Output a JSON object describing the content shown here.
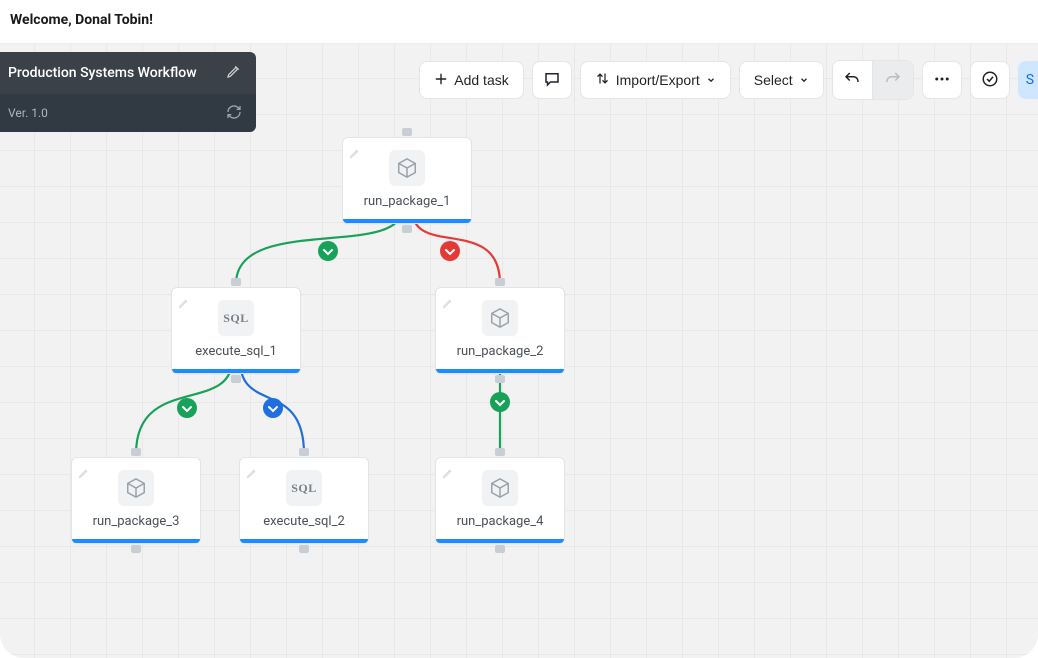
{
  "welcome_text": "Welcome, Donal Tobin!",
  "workflow": {
    "title": "Production Systems Workflow",
    "version": "Ver. 1.0"
  },
  "toolbar": {
    "add_task": "Add task",
    "import_export": "Import/Export",
    "select": "Select",
    "save_and_run": "S"
  },
  "nodes": {
    "run_package_1": {
      "label": "run_package_1",
      "type": "package"
    },
    "execute_sql_1": {
      "label": "execute_sql_1",
      "type": "sql"
    },
    "run_package_2": {
      "label": "run_package_2",
      "type": "package"
    },
    "run_package_3": {
      "label": "run_package_3",
      "type": "package"
    },
    "execute_sql_2": {
      "label": "execute_sql_2",
      "type": "sql"
    },
    "run_package_4": {
      "label": "run_package_4",
      "type": "package"
    }
  },
  "edges": [
    {
      "from": "run_package_1",
      "to": "execute_sql_1",
      "status": "success",
      "color": "#18a158"
    },
    {
      "from": "run_package_1",
      "to": "run_package_2",
      "status": "failure",
      "color": "#e53935"
    },
    {
      "from": "execute_sql_1",
      "to": "run_package_3",
      "status": "success",
      "color": "#18a158"
    },
    {
      "from": "execute_sql_1",
      "to": "execute_sql_2",
      "status": "completed",
      "color": "#1f6fde"
    },
    {
      "from": "run_package_2",
      "to": "run_package_4",
      "status": "success",
      "color": "#18a158"
    }
  ],
  "colors": {
    "success": "#18a158",
    "failure": "#e53935",
    "completed": "#1f6fde",
    "accent": "#1a8cff"
  }
}
